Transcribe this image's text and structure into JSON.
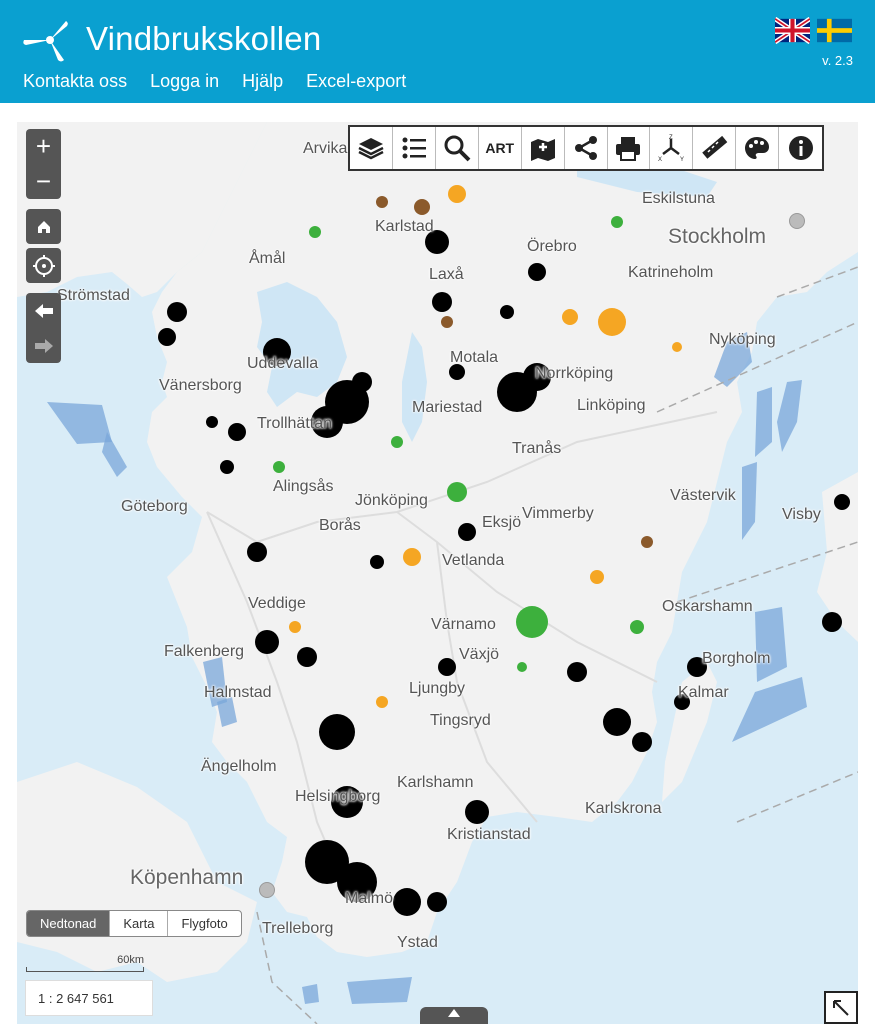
{
  "header": {
    "title": "Vindbrukskollen",
    "version": "v. 2.3",
    "nav": [
      "Kontakta oss",
      "Logga in",
      "Hjälp",
      "Excel-export"
    ]
  },
  "map": {
    "toolbar": {
      "art_label": "ART"
    },
    "zoom": {
      "in": "+",
      "out": "−"
    },
    "places": [
      "Arvika",
      "Karlstad",
      "Örebro",
      "Eskilstuna",
      "Stockholm",
      "Åmål",
      "Laxå",
      "Katrineholm",
      "Strömstad",
      "Motala",
      "Norrköping",
      "Nyköping",
      "Uddevalla",
      "Vänersborg",
      "Mariestad",
      "Linköping",
      "Tranås",
      "Trollhättan",
      "Alingsås",
      "Jönköping",
      "Västervik",
      "Visby",
      "Göteborg",
      "Borås",
      "Eksjö",
      "Vimmerby",
      "Vetlanda",
      "Oskarshamn",
      "Veddige",
      "Värnamo",
      "Falkenberg",
      "Växjö",
      "Borgholm",
      "Halmstad",
      "Ljungby",
      "Kalmar",
      "Tingsryd",
      "Ängelholm",
      "Karlshamn",
      "Karlskrona",
      "Helsingborg",
      "Kristianstad",
      "Köpenhamn",
      "Malmö",
      "Trelleborg",
      "Ystad"
    ],
    "basemap": {
      "options": [
        "Nedtonad",
        "Karta",
        "Flygfoto"
      ],
      "active": "Nedtonad"
    },
    "scalebar_label": "60km",
    "scale_ratio": "1 : 2 647 561",
    "colors": {
      "water": "#d9ecf7",
      "land": "#f2f2f2",
      "turbine": "#000000",
      "turbine_green": "#3db03d",
      "turbine_orange": "#f5a623",
      "turbine_brown": "#8b5a2b",
      "offshore_area": "#7aa7d9",
      "header": "#0aa0d0"
    }
  }
}
